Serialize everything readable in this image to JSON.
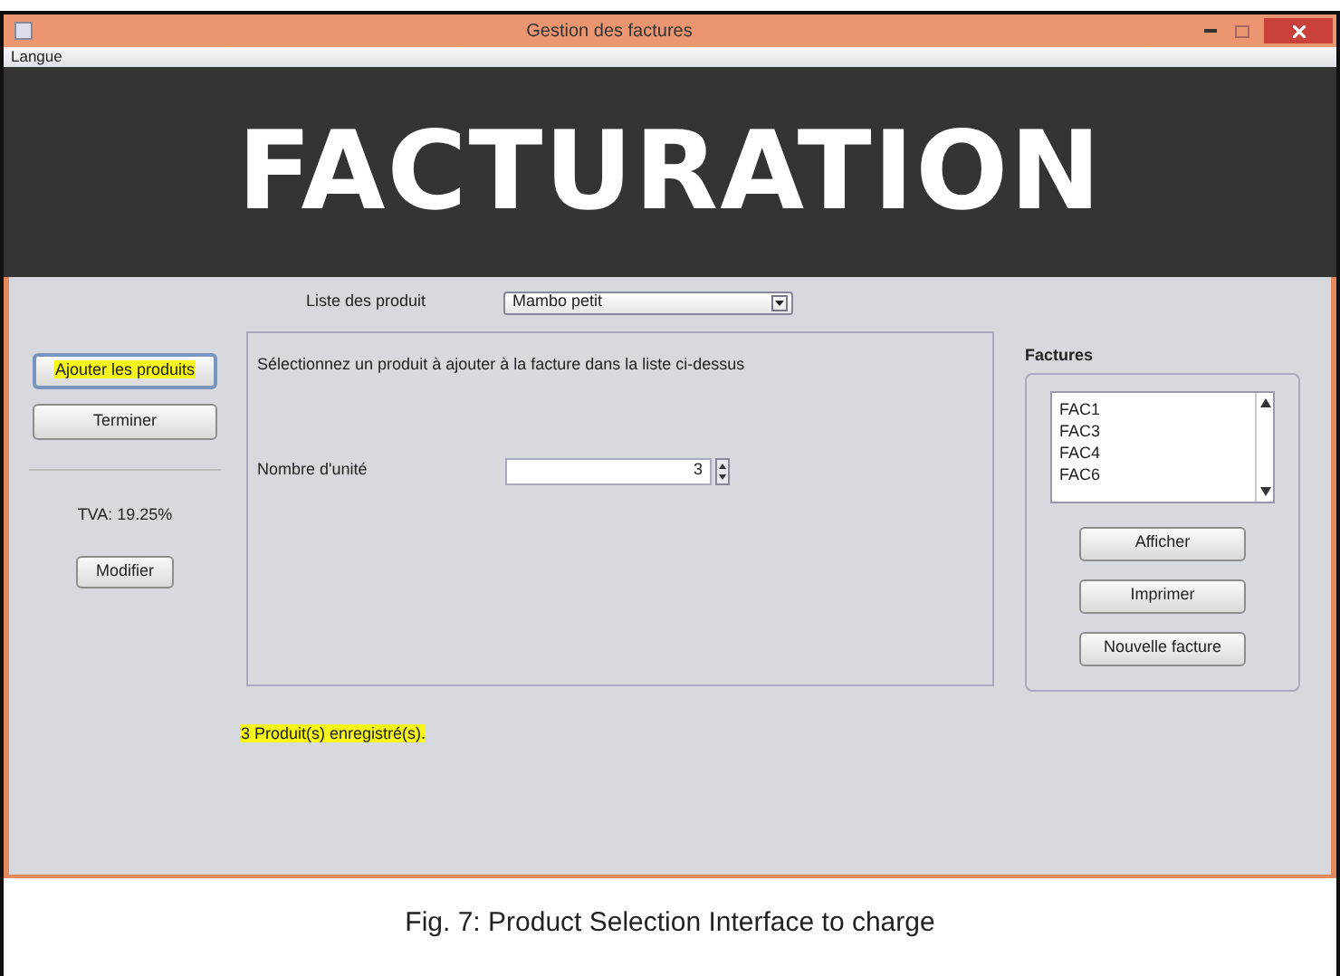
{
  "window": {
    "title": "Gestion des factures"
  },
  "menu": [
    "Langue"
  ],
  "banner": "FACTURATION",
  "left": {
    "buttons": [
      {
        "label": "Ajouter les produits",
        "focused": true,
        "highlighted": true
      },
      {
        "label": "Terminer",
        "focused": false,
        "highlighted": false
      }
    ],
    "tva": "TVA: 19.25%",
    "modify_button": "Modifier"
  },
  "product_list": {
    "label": "Liste des produit",
    "value": "Mambo petit"
  },
  "panel": {
    "instruction": "Sélectionnez un produit à ajouter à la facture dans la liste ci-dessus",
    "quantity_label": "Nombre d'unité",
    "quantity": "3"
  },
  "status": {
    "text": "3 Produit(s) enregistré(s).",
    "highlighted": true
  },
  "invoices": {
    "title": "Factures",
    "items": [
      "FAC1",
      "FAC3",
      "FAC4",
      "FAC6"
    ],
    "buttons": [
      "Afficher",
      "Imprimer",
      "Nouvelle facture"
    ]
  },
  "caption": "Fig. 7: Product Selection Interface to charge"
}
